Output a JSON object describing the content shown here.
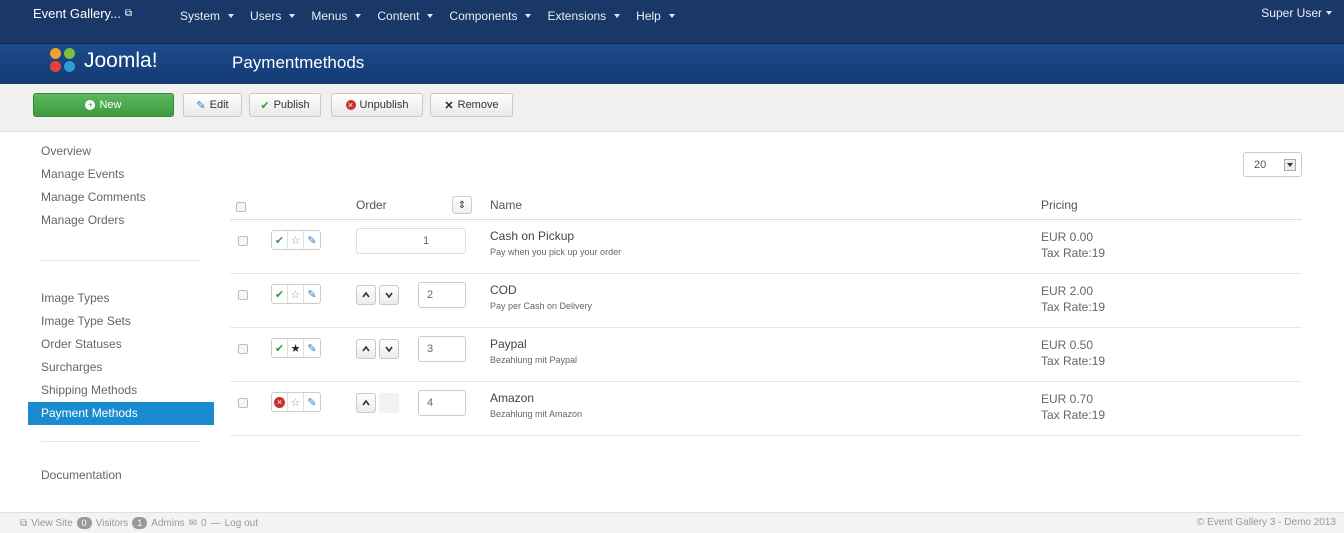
{
  "topnav": {
    "brand": "Event Gallery...",
    "menu": [
      "System",
      "Users",
      "Menus",
      "Content",
      "Components",
      "Extensions",
      "Help"
    ],
    "user": "Super User"
  },
  "header": {
    "logo": "Joomla!",
    "title": "Paymentmethods"
  },
  "toolbar": {
    "new": "New",
    "edit": "Edit",
    "publish": "Publish",
    "unpublish": "Unpublish",
    "remove": "Remove"
  },
  "sidebar": {
    "group1": [
      "Overview",
      "Manage Events",
      "Manage Comments",
      "Manage Orders"
    ],
    "group2": [
      "Image Types",
      "Image Type Sets",
      "Order Statuses",
      "Surcharges",
      "Shipping Methods",
      "Payment Methods"
    ],
    "group3": [
      "Documentation"
    ],
    "active": "Payment Methods"
  },
  "list_limit": "20",
  "table": {
    "headers": {
      "order": "Order",
      "name": "Name",
      "pricing": "Pricing"
    },
    "rows": [
      {
        "name": "Cash on Pickup",
        "desc": "Pay when you pick up your order",
        "price": "EUR 0.00",
        "tax": "Tax Rate:19",
        "order": "1",
        "published": true,
        "default": false
      },
      {
        "name": "COD",
        "desc": "Pay per Cash on Delivery",
        "price": "EUR 2.00",
        "tax": "Tax Rate:19",
        "order": "2",
        "published": true,
        "default": false
      },
      {
        "name": "Paypal",
        "desc": "Bezahlung mit Paypal",
        "price": "EUR 0.50",
        "tax": "Tax Rate:19",
        "order": "3",
        "published": true,
        "default": true
      },
      {
        "name": "Amazon",
        "desc": "Bezahlung mit Amazon",
        "price": "EUR 0.70",
        "tax": "Tax Rate:19",
        "order": "4",
        "published": false,
        "default": false
      }
    ]
  },
  "footer": {
    "view_site": "View Site",
    "visitors_count": "0",
    "visitors": "Visitors",
    "admins_count": "1",
    "admins": "Admins",
    "messages": "0",
    "logout": "Log out",
    "copyright": "© Event Gallery 3 - Demo 2013"
  },
  "colors": {
    "nav": "#1a3867",
    "header": "#17427f",
    "active": "#1a8bd0",
    "new_btn": "#5cb85c"
  }
}
